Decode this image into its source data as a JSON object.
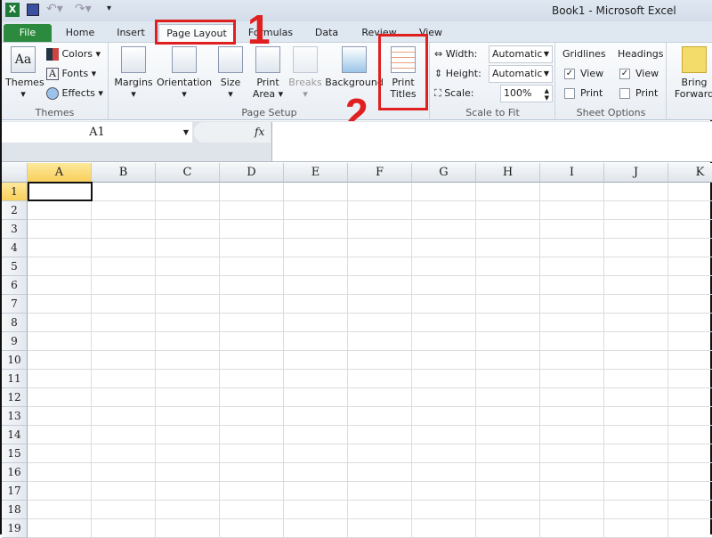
{
  "window": {
    "title": "Book1  -  Microsoft Excel"
  },
  "tabs": [
    {
      "label": "File"
    },
    {
      "label": "Home"
    },
    {
      "label": "Insert"
    },
    {
      "label": "Page Layout"
    },
    {
      "label": "Formulas"
    },
    {
      "label": "Data"
    },
    {
      "label": "Review"
    },
    {
      "label": "View"
    }
  ],
  "ribbon": {
    "themes": {
      "label": "Themes",
      "themes_btn": "Themes",
      "colors": "Colors",
      "fonts": "Fonts",
      "effects": "Effects"
    },
    "page_setup": {
      "label": "Page Setup",
      "margins": "Margins",
      "orientation": "Orientation",
      "size": "Size",
      "print_area_1": "Print",
      "print_area_2": "Area",
      "breaks": "Breaks",
      "background": "Background",
      "print_titles_1": "Print",
      "print_titles_2": "Titles"
    },
    "scale_to_fit": {
      "label": "Scale to Fit",
      "width_label": "Width:",
      "width_value": "Automatic",
      "height_label": "Height:",
      "height_value": "Automatic",
      "scale_label": "Scale:",
      "scale_value": "100%"
    },
    "sheet_options": {
      "label": "Sheet Options",
      "gridlines": "Gridlines",
      "headings": "Headings",
      "view": "View",
      "print": "Print",
      "gridlines_view": true,
      "gridlines_print": false,
      "headings_view": true,
      "headings_print": false
    },
    "arrange": {
      "bring_1": "Bring",
      "bring_2": "Forward"
    }
  },
  "annotations": {
    "step1": "1",
    "step2": "2",
    "color": "#e02020"
  },
  "formula_bar": {
    "name_box": "A1",
    "fx": "fx",
    "value": ""
  },
  "sheet": {
    "columns": [
      "A",
      "B",
      "C",
      "D",
      "E",
      "F",
      "G",
      "H",
      "I",
      "J",
      "K"
    ],
    "rows": [
      "1",
      "2",
      "3",
      "4",
      "5",
      "6",
      "7",
      "8",
      "9",
      "10",
      "11",
      "12",
      "13",
      "14",
      "15",
      "16",
      "17",
      "18",
      "19"
    ],
    "active_cell": "A1"
  }
}
